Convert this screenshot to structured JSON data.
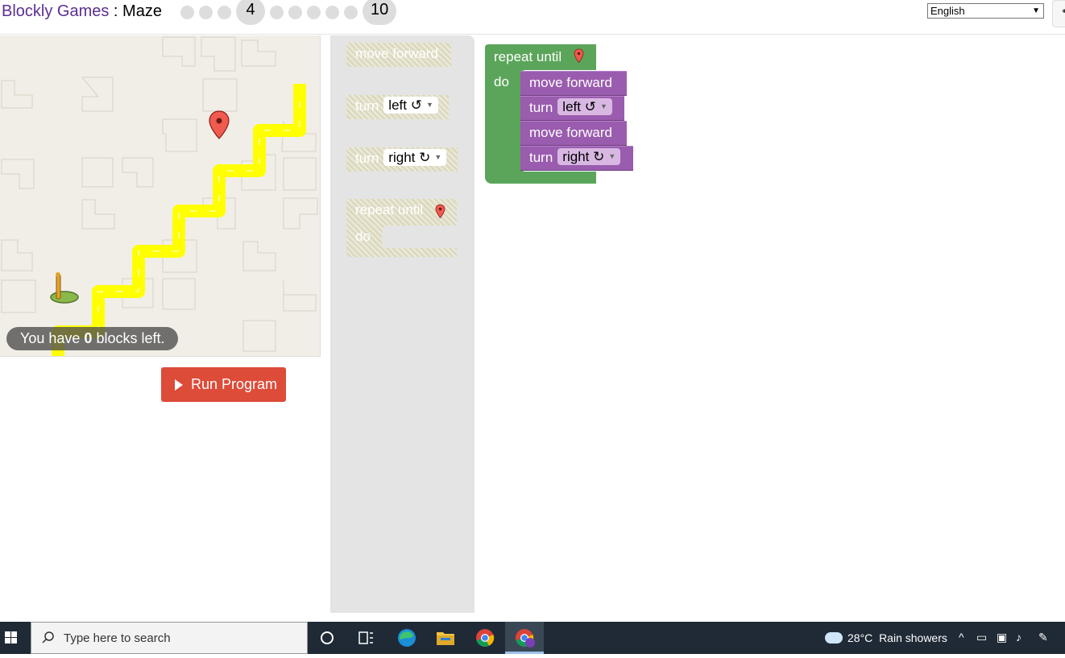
{
  "header": {
    "app_name": "Blockly Games",
    "separator": " : ",
    "game_name": "Maze",
    "levels": {
      "current": "4",
      "last": "10"
    },
    "language": "English"
  },
  "maze": {
    "capacity_prefix": "You have ",
    "capacity_count": "0",
    "capacity_suffix": " blocks left."
  },
  "run_button": {
    "label": "Run Program"
  },
  "toolbox": {
    "move_forward": "move forward",
    "turn": "turn",
    "left": "left ↺",
    "right": "right ↻",
    "repeat_until": "repeat until",
    "do": "do"
  },
  "program": {
    "repeat_until": "repeat until",
    "do": "do",
    "statements": [
      "move forward",
      "turn",
      "move forward",
      "turn"
    ],
    "turn_left": "left ↺",
    "turn_right": "right ↻"
  },
  "taskbar": {
    "search_placeholder": "Type here to search",
    "temperature": "28°C",
    "weather_text": "Rain showers"
  },
  "colors": {
    "loop_block": "#5ba55b",
    "movement_block": "#9a5cae",
    "run_button": "#dd4b39",
    "path": "#ffff00"
  }
}
